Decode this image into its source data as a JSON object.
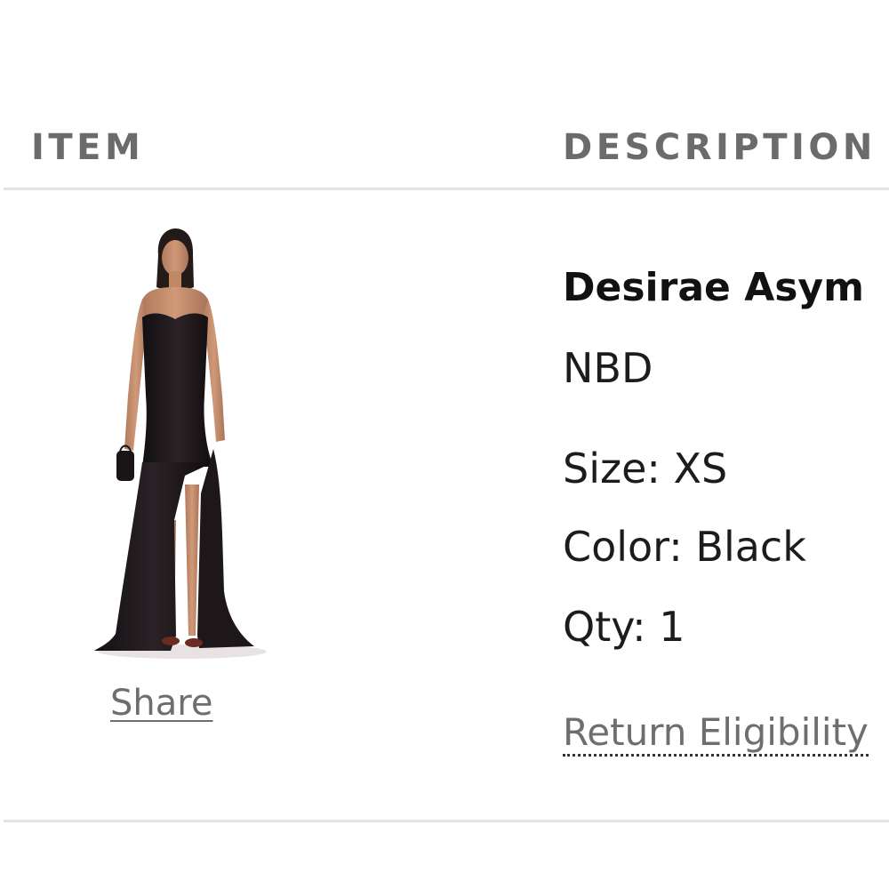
{
  "table": {
    "headers": {
      "item": "ITEM",
      "description": "DESCRIPTION"
    }
  },
  "item": {
    "image_alt": "Desirae Asymmetrical Gown",
    "share_label": "Share",
    "name": "Desirae Asym",
    "brand": "NBD",
    "size_text": "Size: XS",
    "color_text": "Color: Black",
    "qty_text": "Qty: 1",
    "return_link": "Return Eligibility"
  },
  "colors": {
    "header_text": "#6b6b6b",
    "link_text": "#6e6e6e",
    "divider": "#e3e3e3",
    "dress": "#1b1417"
  }
}
